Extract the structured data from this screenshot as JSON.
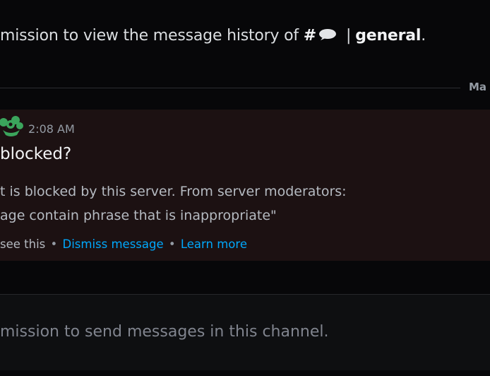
{
  "history_notice": {
    "prefix": "mission to view the message history of ",
    "hash": "#",
    "channel_name": "general",
    "suffix": "."
  },
  "divider": {
    "date_label": "Ma"
  },
  "message": {
    "timestamp": "2:08 AM",
    "text": "blocked?",
    "blocked_reason_line1": "t is blocked by this server. From server moderators:",
    "blocked_reason_line2": "age contain phrase that is inappropriate\"",
    "visibility_text": "see this",
    "dismiss_label": "Dismiss message",
    "learn_more_label": "Learn more",
    "separator": "•"
  },
  "composer": {
    "disabled_text": "mission to send messages in this channel."
  },
  "colors": {
    "background": "#070709",
    "blocked_message_bg": "#1c1112",
    "link": "#00a8fc",
    "muted_text": "#949ba4",
    "flower_green": "#3ba55c"
  },
  "icons": {
    "channel_emoji": "speech-bubble-icon",
    "avatar_decoration": "flower-icon"
  }
}
